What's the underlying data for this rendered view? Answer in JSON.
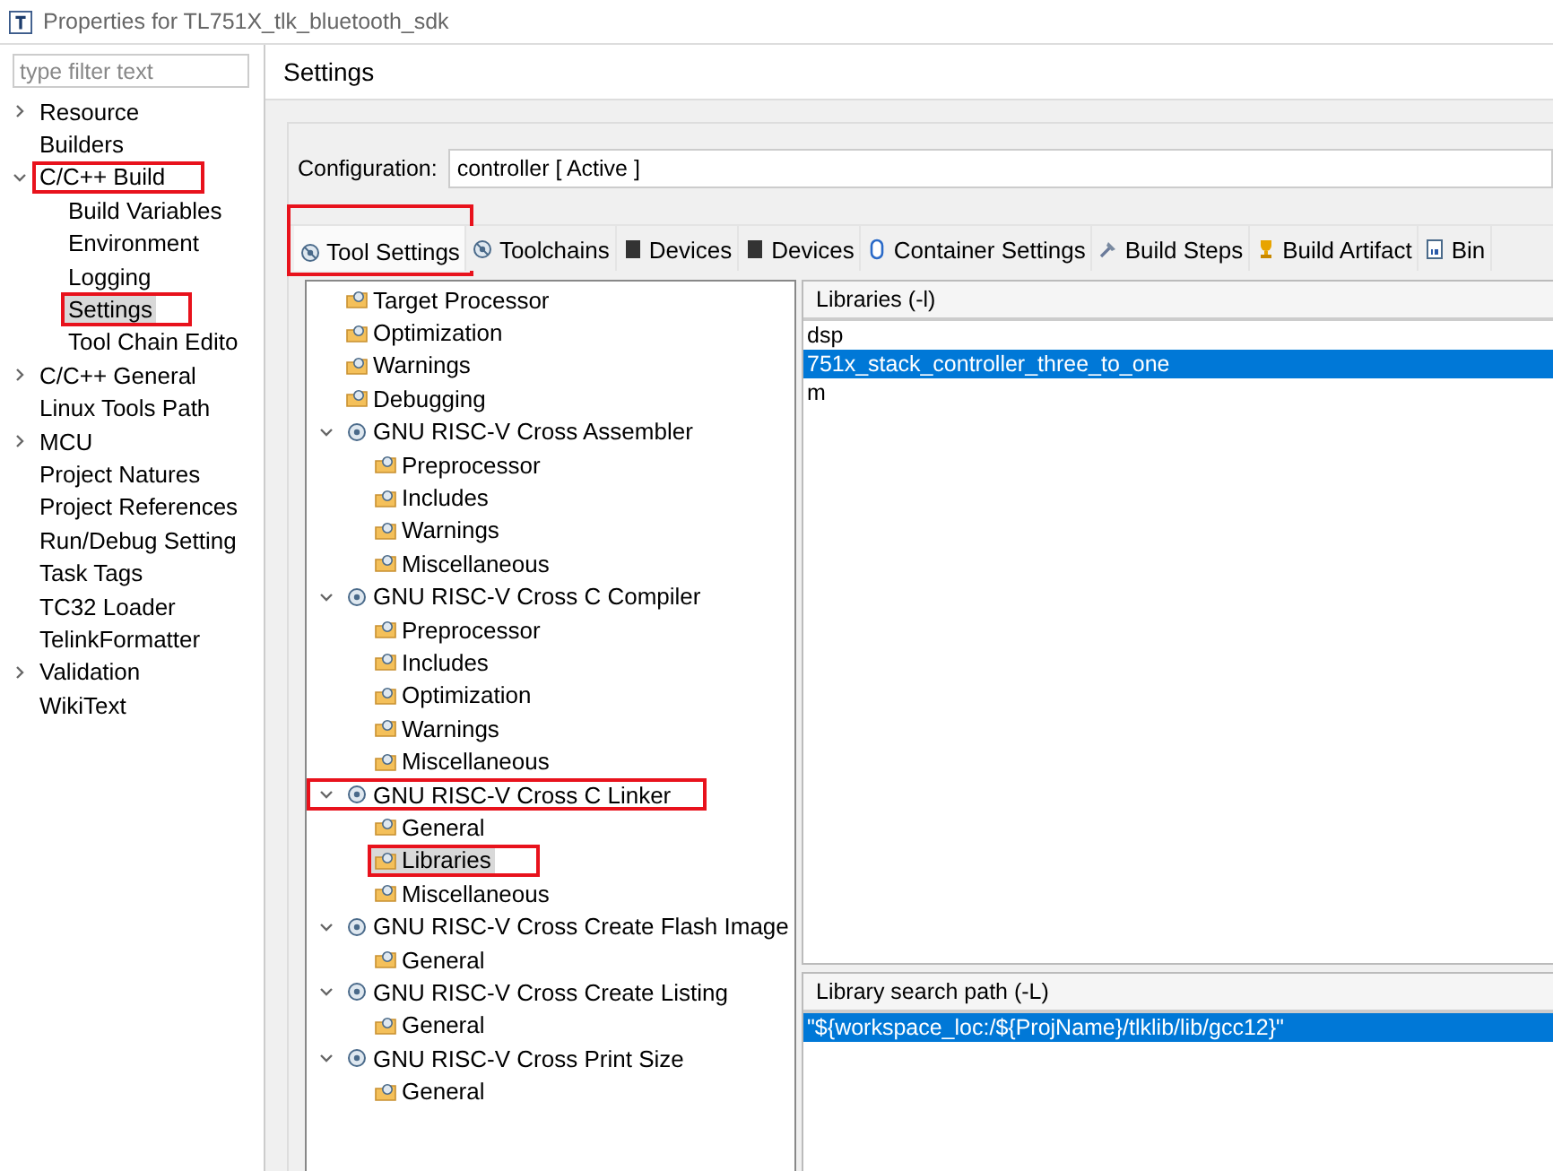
{
  "window": {
    "title": "Properties for TL751X_tlk_bluetooth_sdk"
  },
  "filter": {
    "placeholder": "type filter text"
  },
  "sidebar": {
    "items": [
      {
        "label": "Resource",
        "expanded": false,
        "highlighted": false
      },
      {
        "label": "Builders",
        "highlighted": false
      },
      {
        "label": "C/C++ Build",
        "expanded": true,
        "highlighted": true,
        "children": [
          {
            "label": "Build Variables",
            "selected": false,
            "highlighted": false
          },
          {
            "label": "Environment",
            "selected": false,
            "highlighted": false
          },
          {
            "label": "Logging",
            "selected": false,
            "highlighted": false
          },
          {
            "label": "Settings",
            "selected": true,
            "highlighted": true
          },
          {
            "label": "Tool Chain Edito",
            "selected": false,
            "highlighted": false
          }
        ]
      },
      {
        "label": "C/C++ General",
        "expanded": false,
        "highlighted": false
      },
      {
        "label": "Linux Tools Path",
        "highlighted": false
      },
      {
        "label": "MCU",
        "expanded": false,
        "highlighted": false
      },
      {
        "label": "Project Natures",
        "highlighted": false
      },
      {
        "label": "Project References",
        "highlighted": false
      },
      {
        "label": "Run/Debug Setting",
        "highlighted": false
      },
      {
        "label": "Task Tags",
        "highlighted": false
      },
      {
        "label": "TC32 Loader",
        "highlighted": false
      },
      {
        "label": "TelinkFormatter",
        "highlighted": false
      },
      {
        "label": "Validation",
        "expanded": false,
        "highlighted": false
      },
      {
        "label": "WikiText",
        "highlighted": false
      }
    ]
  },
  "page": {
    "title": "Settings",
    "configuration_label": "Configuration:",
    "configuration_value": "controller  [ Active ]"
  },
  "tabs": [
    {
      "label": "Tool Settings",
      "kind": "tool",
      "selected": true,
      "highlighted": true
    },
    {
      "label": "Toolchains",
      "kind": "tool",
      "selected": false,
      "highlighted": false
    },
    {
      "label": "Devices",
      "kind": "chip",
      "selected": false,
      "highlighted": false
    },
    {
      "label": "Devices",
      "kind": "chip",
      "selected": false,
      "highlighted": false
    },
    {
      "label": "Container Settings",
      "kind": "container",
      "selected": false,
      "highlighted": false
    },
    {
      "label": "Build Steps",
      "kind": "steps",
      "selected": false,
      "highlighted": false
    },
    {
      "label": "Build Artifact",
      "kind": "artifact",
      "selected": false,
      "highlighted": false
    },
    {
      "label": "Bin",
      "kind": "binary",
      "selected": false,
      "highlighted": false
    }
  ],
  "tool_tree": [
    {
      "label": "Target Processor",
      "kind": "page",
      "selected": false,
      "highlighted": false
    },
    {
      "label": "Optimization",
      "kind": "page",
      "selected": false,
      "highlighted": false
    },
    {
      "label": "Warnings",
      "kind": "page",
      "selected": false,
      "highlighted": false
    },
    {
      "label": "Debugging",
      "kind": "page",
      "selected": false,
      "highlighted": false
    },
    {
      "label": "GNU RISC-V Cross Assembler",
      "kind": "tool",
      "expanded": true,
      "selected": false,
      "highlighted": false,
      "children": [
        {
          "label": "Preprocessor",
          "kind": "page",
          "selected": false,
          "highlighted": false
        },
        {
          "label": "Includes",
          "kind": "page",
          "selected": false,
          "highlighted": false
        },
        {
          "label": "Warnings",
          "kind": "page",
          "selected": false,
          "highlighted": false
        },
        {
          "label": "Miscellaneous",
          "kind": "page",
          "selected": false,
          "highlighted": false
        }
      ]
    },
    {
      "label": "GNU RISC-V Cross C Compiler",
      "kind": "tool",
      "expanded": true,
      "selected": false,
      "highlighted": false,
      "children": [
        {
          "label": "Preprocessor",
          "kind": "page",
          "selected": false,
          "highlighted": false
        },
        {
          "label": "Includes",
          "kind": "page",
          "selected": false,
          "highlighted": false
        },
        {
          "label": "Optimization",
          "kind": "page",
          "selected": false,
          "highlighted": false
        },
        {
          "label": "Warnings",
          "kind": "page",
          "selected": false,
          "highlighted": false
        },
        {
          "label": "Miscellaneous",
          "kind": "page",
          "selected": false,
          "highlighted": false
        }
      ]
    },
    {
      "label": "GNU RISC-V Cross C Linker",
      "kind": "tool",
      "expanded": true,
      "selected": false,
      "highlighted": true,
      "children": [
        {
          "label": "General",
          "kind": "page",
          "selected": false,
          "highlighted": false
        },
        {
          "label": "Libraries",
          "kind": "page",
          "selected": true,
          "highlighted": true
        },
        {
          "label": "Miscellaneous",
          "kind": "page",
          "selected": false,
          "highlighted": false
        }
      ]
    },
    {
      "label": "GNU RISC-V Cross Create Flash Image",
      "kind": "tool",
      "expanded": true,
      "selected": false,
      "highlighted": false,
      "children": [
        {
          "label": "General",
          "kind": "page",
          "selected": false,
          "highlighted": false
        }
      ]
    },
    {
      "label": "GNU RISC-V Cross Create Listing",
      "kind": "tool",
      "expanded": true,
      "selected": false,
      "highlighted": false,
      "children": [
        {
          "label": "General",
          "kind": "page",
          "selected": false,
          "highlighted": false
        }
      ]
    },
    {
      "label": "GNU RISC-V Cross Print Size",
      "kind": "tool",
      "expanded": true,
      "selected": false,
      "highlighted": false,
      "children": [
        {
          "label": "General",
          "kind": "page",
          "selected": false,
          "highlighted": false
        }
      ]
    }
  ],
  "libraries": {
    "title": "Libraries (-l)",
    "items": [
      {
        "label": "dsp",
        "selected": false
      },
      {
        "label": "751x_stack_controller_three_to_one",
        "selected": true
      },
      {
        "label": "m",
        "selected": false
      }
    ]
  },
  "search_paths": {
    "title": "Library search path (-L)",
    "items": [
      {
        "label": "\"${workspace_loc:/${ProjName}/tlklib/lib/gcc12}\"",
        "selected": true
      }
    ]
  }
}
